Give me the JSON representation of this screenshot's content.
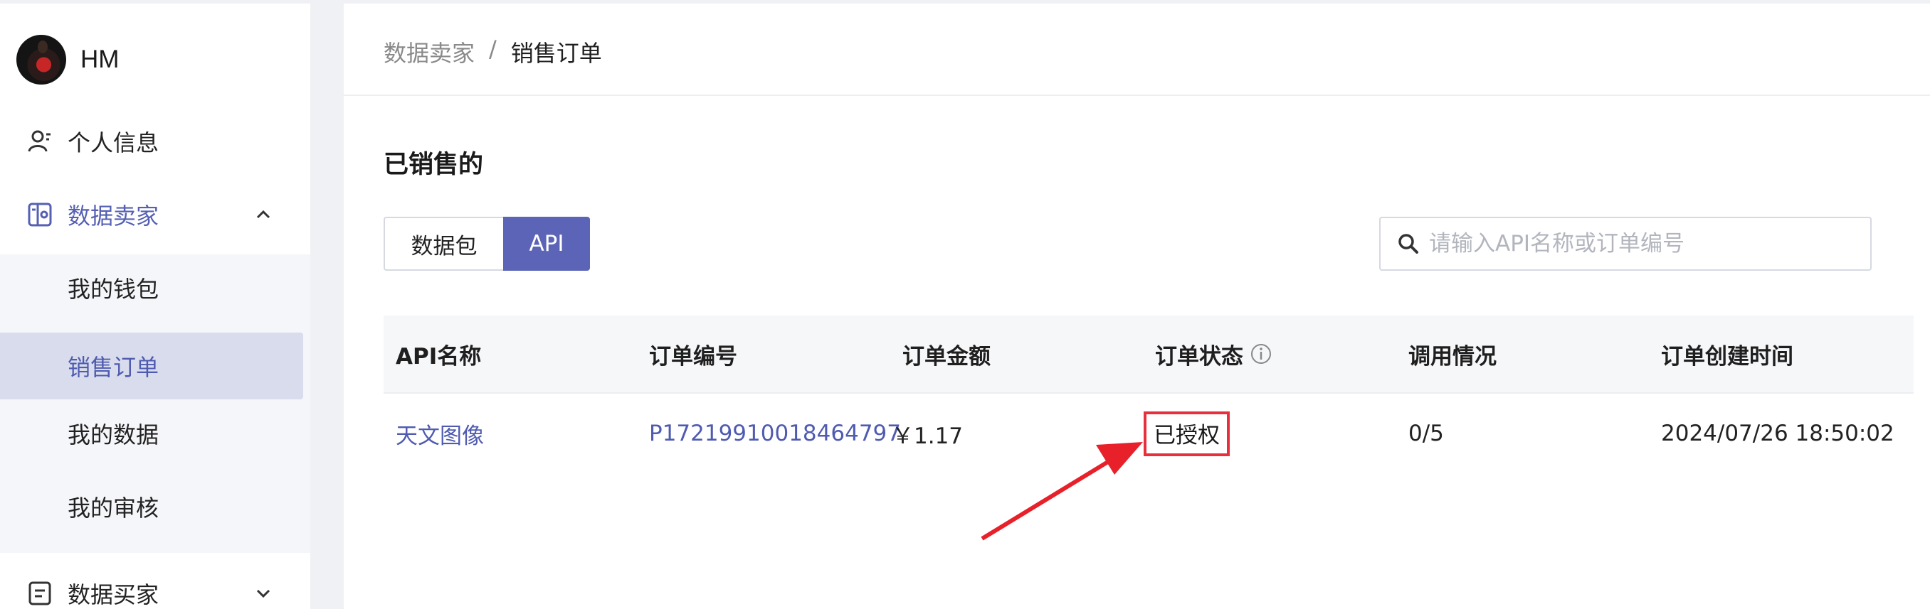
{
  "user": {
    "name": "HM"
  },
  "sidebar": {
    "items": [
      {
        "label": "个人信息",
        "icon": "user-icon"
      },
      {
        "label": "数据卖家",
        "icon": "seller-icon",
        "expanded": true
      },
      {
        "label": "数据买家",
        "icon": "buyer-icon",
        "expanded": false
      }
    ],
    "sub_items": [
      {
        "label": "我的钱包"
      },
      {
        "label": "销售订单",
        "selected": true
      },
      {
        "label": "我的数据"
      },
      {
        "label": "我的审核"
      }
    ]
  },
  "breadcrumb": {
    "parent": "数据卖家",
    "separator": "/",
    "current": "销售订单"
  },
  "section_title": "已销售的",
  "tabs": [
    {
      "label": "数据包",
      "active": false
    },
    {
      "label": "API",
      "active": true
    }
  ],
  "search": {
    "placeholder": "请输入API名称或订单编号",
    "value": ""
  },
  "table": {
    "headers": [
      "API名称",
      "订单编号",
      "订单金额",
      "订单状态",
      "调用情况",
      "订单创建时间"
    ],
    "rows": [
      {
        "api_name": "天文图像",
        "order_no": "P17219910018464797",
        "amount": "￥1.17",
        "status": "已授权",
        "usage": "0/5",
        "created": "2024/07/26 18:50:02"
      }
    ]
  },
  "colors": {
    "accent": "#5b64b6",
    "link": "#4f5bb0",
    "highlight_box": "#e8303c",
    "annotation_arrow": "#e8202a"
  }
}
